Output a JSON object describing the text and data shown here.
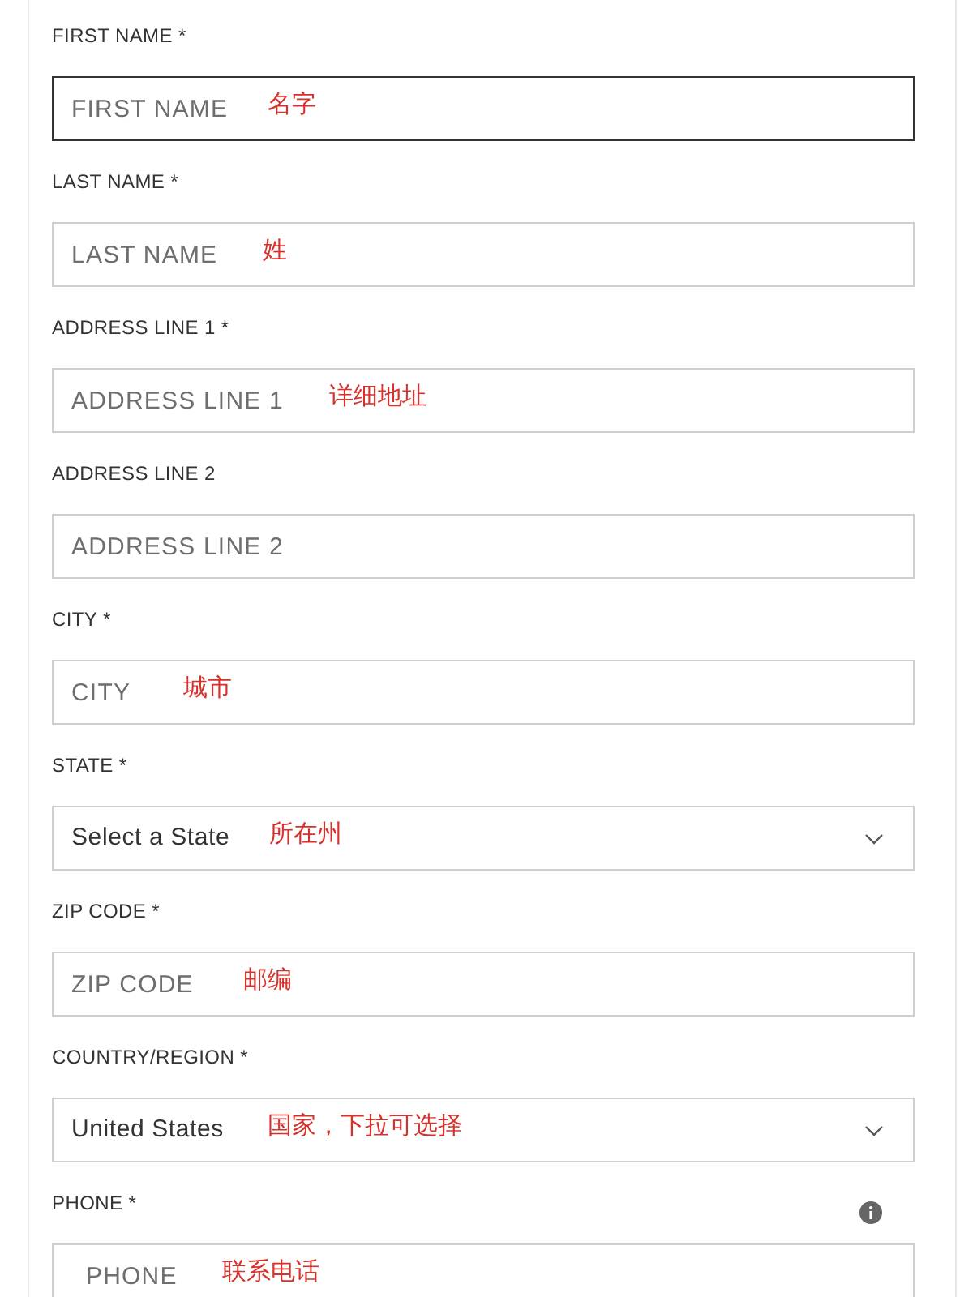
{
  "fields": [
    {
      "kind": "text",
      "label": "FIRST NAME *",
      "placeholder": "FIRST NAME",
      "focused": true,
      "note": "名字"
    },
    {
      "kind": "text",
      "label": "LAST NAME *",
      "placeholder": "LAST NAME",
      "focused": false,
      "note": "姓"
    },
    {
      "kind": "text",
      "label": "ADDRESS LINE 1 *",
      "placeholder": "ADDRESS LINE 1",
      "focused": false,
      "note": "详细地址"
    },
    {
      "kind": "text",
      "label": "ADDRESS LINE 2",
      "placeholder": "ADDRESS LINE 2",
      "focused": false
    },
    {
      "kind": "text",
      "label": "CITY *",
      "placeholder": "CITY",
      "focused": false,
      "note": "城市"
    },
    {
      "kind": "select",
      "label": "STATE *",
      "value": "Select a State",
      "focused": false,
      "note": "所在州"
    },
    {
      "kind": "text",
      "label": "ZIP CODE *",
      "placeholder": "ZIP CODE",
      "focused": false,
      "note": "邮编"
    },
    {
      "kind": "select",
      "label": "COUNTRY/REGION *",
      "value": "United States",
      "focused": false,
      "note": "国家，下拉可选择"
    },
    {
      "kind": "phone",
      "label": "PHONE *",
      "placeholder": "PHONE",
      "focused": false,
      "note": "联系电话"
    }
  ]
}
